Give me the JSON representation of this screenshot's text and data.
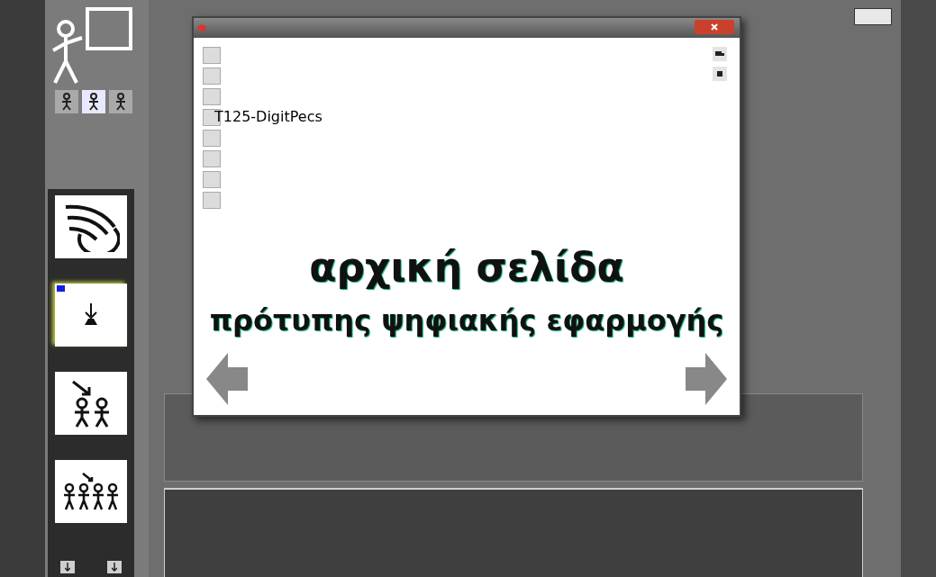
{
  "window": {
    "project_label": "T125-DigitPecs",
    "heading": "αρχική σελίδα",
    "subheading": "πρότυπης ψηφιακής εφαρμογής"
  },
  "cards": [
    {
      "kind": "swirl",
      "selected": false
    },
    {
      "kind": "push",
      "selected": true
    },
    {
      "kind": "pair",
      "selected": false
    },
    {
      "kind": "group",
      "selected": false
    }
  ],
  "mode_buttons": [
    {
      "selected": false
    },
    {
      "selected": true
    },
    {
      "selected": false
    }
  ]
}
